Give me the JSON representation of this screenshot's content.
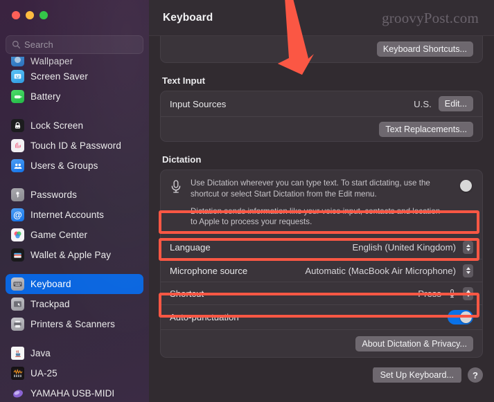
{
  "window": {
    "title": "Keyboard",
    "watermark": "groovyPost.com",
    "traffic_lights": [
      "close-red",
      "minimize-yellow",
      "zoom-green"
    ]
  },
  "sidebar": {
    "search": {
      "placeholder": "Search",
      "value": ""
    },
    "groups": [
      {
        "items": [
          {
            "label": "Wallpaper",
            "icon": "wallpaper-icon",
            "clipped": true,
            "selected": false
          },
          {
            "label": "Screen Saver",
            "icon": "screen-saver-icon",
            "selected": false
          },
          {
            "label": "Battery",
            "icon": "battery-icon",
            "selected": false
          }
        ]
      },
      {
        "items": [
          {
            "label": "Lock Screen",
            "icon": "lock-icon",
            "selected": false
          },
          {
            "label": "Touch ID & Password",
            "icon": "touch-id-icon",
            "selected": false
          },
          {
            "label": "Users & Groups",
            "icon": "users-icon",
            "selected": false
          }
        ]
      },
      {
        "items": [
          {
            "label": "Passwords",
            "icon": "key-icon",
            "selected": false
          },
          {
            "label": "Internet Accounts",
            "icon": "at-sign-icon",
            "selected": false
          },
          {
            "label": "Game Center",
            "icon": "game-center-icon",
            "selected": false
          },
          {
            "label": "Wallet & Apple Pay",
            "icon": "wallet-icon",
            "selected": false
          }
        ]
      },
      {
        "items": [
          {
            "label": "Keyboard",
            "icon": "keyboard-icon",
            "selected": true
          },
          {
            "label": "Trackpad",
            "icon": "trackpad-icon",
            "selected": false
          },
          {
            "label": "Printers & Scanners",
            "icon": "printer-icon",
            "selected": false
          }
        ]
      },
      {
        "items": [
          {
            "label": "Java",
            "icon": "java-icon",
            "selected": false
          },
          {
            "label": "UA-25",
            "icon": "ua25-icon",
            "selected": false
          },
          {
            "label": "YAMAHA USB-MIDI",
            "icon": "yamaha-icon",
            "selected": false
          }
        ]
      }
    ]
  },
  "main": {
    "keyboard_section": {
      "shortcuts_button": "Keyboard Shortcuts..."
    },
    "text_input": {
      "heading": "Text Input",
      "input_sources": {
        "label": "Input Sources",
        "value": "U.S.",
        "edit_button": "Edit..."
      },
      "text_replacements_button": "Text Replacements..."
    },
    "dictation": {
      "heading": "Dictation",
      "mic_icon": "microphone-icon",
      "description_1": "Use Dictation wherever you can type text. To start dictating, use the shortcut or select Start Dictation from the Edit menu.",
      "description_2": "Dictation sends information like your voice input, contacts and location to Apple to process your requests.",
      "enabled": true,
      "rows": [
        {
          "label": "Language",
          "value": "English (United Kingdom)",
          "control": "popup-stepper",
          "highlighted": true
        },
        {
          "label": "Microphone source",
          "value": "Automatic (MacBook Air Microphone)",
          "control": "popup-stepper",
          "highlighted": true
        },
        {
          "label": "Shortcut",
          "value": "Press",
          "control": "popup-stepper-mic",
          "highlighted": false
        },
        {
          "label": "Auto-punctuation",
          "value": "",
          "control": "toggle-on",
          "highlighted": true
        }
      ],
      "about_button": "About Dictation & Privacy..."
    },
    "footer": {
      "setup_button": "Set Up Keyboard...",
      "help_button": "help-question-icon"
    }
  },
  "annotations": {
    "arrow_color": "#fb5744",
    "highlight_color": "#fb5744",
    "arrow_name": "red-pointer-arrow",
    "highlight_targets": [
      "Language",
      "Microphone source",
      "Auto-punctuation"
    ]
  }
}
